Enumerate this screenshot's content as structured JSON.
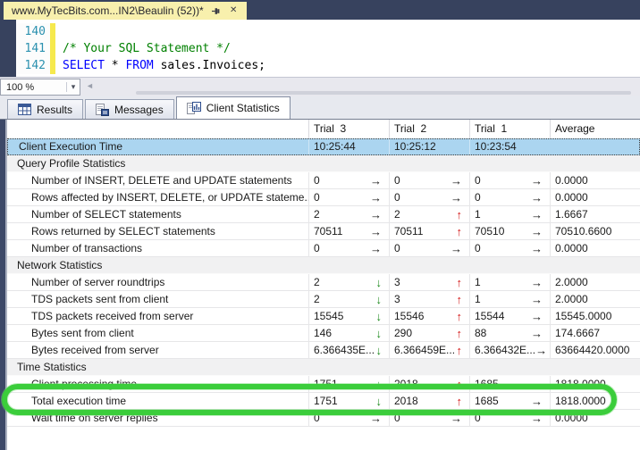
{
  "doc_tab": {
    "title": "www.MyTecBits.com...IN2\\Beaulin (52))*",
    "close_glyph": "✕"
  },
  "editor": {
    "lines": [
      {
        "num": "140",
        "segments": []
      },
      {
        "num": "141",
        "segments": [
          {
            "c": "comment",
            "t": "/* Your SQL Statement */"
          }
        ]
      },
      {
        "num": "142",
        "segments": [
          {
            "c": "keyword",
            "t": "SELECT"
          },
          {
            "c": "plain",
            "t": " * "
          },
          {
            "c": "keyword",
            "t": "FROM"
          },
          {
            "c": "plain",
            "t": " sales.Invoices;"
          }
        ]
      }
    ],
    "zoom_value": "100 %",
    "zoom_caret": "▾",
    "scroll_left_arrow": "◄"
  },
  "result_tabs": [
    {
      "label": "Results",
      "icon": "results-grid-icon",
      "active": false
    },
    {
      "label": "Messages",
      "icon": "messages-icon",
      "active": false
    },
    {
      "label": "Client Statistics",
      "icon": "client-statistics-icon",
      "active": true
    }
  ],
  "grid": {
    "columns": [
      "",
      "Trial  3",
      "Trial  2",
      "Trial  1",
      "Average"
    ],
    "arrow_glyphs": {
      "right": "→",
      "up": "↑",
      "down": "↓"
    },
    "rows": [
      {
        "type": "time",
        "label": "Client Execution Time",
        "values": [
          {
            "v": "10:25:44"
          },
          {
            "v": "10:25:12"
          },
          {
            "v": "10:23:54"
          }
        ],
        "avg": ""
      },
      {
        "type": "section",
        "label": "Query Profile Statistics"
      },
      {
        "type": "data",
        "label": "Number of INSERT, DELETE and UPDATE statements",
        "values": [
          {
            "v": "0",
            "a": "right"
          },
          {
            "v": "0",
            "a": "right"
          },
          {
            "v": "0",
            "a": "right"
          }
        ],
        "avg": "0.0000"
      },
      {
        "type": "data",
        "label": "Rows affected by INSERT, DELETE, or UPDATE stateme...",
        "values": [
          {
            "v": "0",
            "a": "right"
          },
          {
            "v": "0",
            "a": "right"
          },
          {
            "v": "0",
            "a": "right"
          }
        ],
        "avg": "0.0000"
      },
      {
        "type": "data",
        "label": "Number of SELECT statements",
        "values": [
          {
            "v": "2",
            "a": "right"
          },
          {
            "v": "2",
            "a": "up"
          },
          {
            "v": "1",
            "a": "right"
          }
        ],
        "avg": "1.6667"
      },
      {
        "type": "data",
        "label": "Rows returned by SELECT statements",
        "values": [
          {
            "v": "70511",
            "a": "right"
          },
          {
            "v": "70511",
            "a": "up"
          },
          {
            "v": "70510",
            "a": "right"
          }
        ],
        "avg": "70510.6600"
      },
      {
        "type": "data",
        "label": "Number of transactions",
        "values": [
          {
            "v": "0",
            "a": "right"
          },
          {
            "v": "0",
            "a": "right"
          },
          {
            "v": "0",
            "a": "right"
          }
        ],
        "avg": "0.0000"
      },
      {
        "type": "section",
        "label": "Network Statistics"
      },
      {
        "type": "data",
        "label": "Number of server roundtrips",
        "values": [
          {
            "v": "2",
            "a": "down"
          },
          {
            "v": "3",
            "a": "up"
          },
          {
            "v": "1",
            "a": "right"
          }
        ],
        "avg": "2.0000"
      },
      {
        "type": "data",
        "label": "TDS packets sent from client",
        "values": [
          {
            "v": "2",
            "a": "down"
          },
          {
            "v": "3",
            "a": "up"
          },
          {
            "v": "1",
            "a": "right"
          }
        ],
        "avg": "2.0000"
      },
      {
        "type": "data",
        "label": "TDS packets received from server",
        "values": [
          {
            "v": "15545",
            "a": "down"
          },
          {
            "v": "15546",
            "a": "up"
          },
          {
            "v": "15544",
            "a": "right"
          }
        ],
        "avg": "15545.0000"
      },
      {
        "type": "data",
        "label": "Bytes sent from client",
        "values": [
          {
            "v": "146",
            "a": "down"
          },
          {
            "v": "290",
            "a": "up"
          },
          {
            "v": "88",
            "a": "right"
          }
        ],
        "avg": "174.6667"
      },
      {
        "type": "data",
        "label": "Bytes received from server",
        "values": [
          {
            "v": "6.366435E...",
            "a": "down"
          },
          {
            "v": "6.366459E...",
            "a": "up"
          },
          {
            "v": "6.366432E...",
            "a": "right"
          }
        ],
        "avg": "63664420.0000"
      },
      {
        "type": "section",
        "label": "Time Statistics"
      },
      {
        "type": "data",
        "label": "Client processing time",
        "values": [
          {
            "v": "1751",
            "a": "down"
          },
          {
            "v": "2018",
            "a": "up"
          },
          {
            "v": "1685",
            "a": "right"
          }
        ],
        "avg": "1818.0000"
      },
      {
        "type": "data",
        "label": "Total execution time",
        "highlighted": true,
        "values": [
          {
            "v": "1751",
            "a": "down"
          },
          {
            "v": "2018",
            "a": "up"
          },
          {
            "v": "1685",
            "a": "right"
          }
        ],
        "avg": "1818.0000"
      },
      {
        "type": "data",
        "label": "Wait time on server replies",
        "values": [
          {
            "v": "0",
            "a": "right"
          },
          {
            "v": "0",
            "a": "right"
          },
          {
            "v": "0",
            "a": "right"
          }
        ],
        "avg": "0.0000"
      }
    ]
  },
  "colors": {
    "selection_blue": "#abd5f0",
    "highlight_green": "#3bcd3b",
    "arrow_up_red": "#d31616",
    "arrow_down_green": "#1b891b",
    "tab_yellow": "#f8f0ad",
    "keyword_blue": "#0000ff",
    "comment_green": "#008000",
    "line_number_teal": "#2b91af"
  }
}
